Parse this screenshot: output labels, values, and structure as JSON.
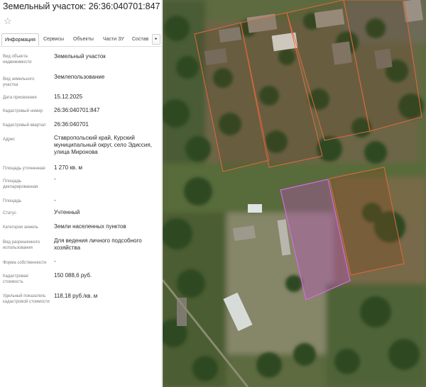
{
  "header": {
    "title": "Земельный участок: 26:36:040701:847",
    "favorite_icon": "star-outline-icon"
  },
  "tabs": [
    {
      "label": "Информация",
      "active": true
    },
    {
      "label": "Сервисы",
      "active": false
    },
    {
      "label": "Объекты",
      "active": false
    },
    {
      "label": "Части ЗУ",
      "active": false
    },
    {
      "label": "Состав",
      "active": false
    }
  ],
  "tabs_more_icon": "chevron-right-icon",
  "tabs_more_glyph": "▸",
  "fields": {
    "object_type": {
      "label": "Вид объекта недвижимости",
      "value": "Земельный участок"
    },
    "land_type": {
      "label": "Вид земельного участка",
      "value": "Землепользование"
    },
    "assigned_date": {
      "label": "Дата присвоения",
      "value": "15.12.2025"
    },
    "cadastral_number": {
      "label": "Кадастровый номер",
      "value": "26:36:040701:847"
    },
    "cadastral_quarter": {
      "label": "Кадастровый квартал",
      "value": "26:36:040701"
    },
    "address": {
      "label": "Адрес",
      "value": "Ставропольский край, Курский муниципальный округ, село Эдиссия, улица Миронова"
    },
    "area_specified": {
      "label": "Площадь уточненная",
      "value": "1 270 кв. м"
    },
    "area_declared": {
      "label": "Площадь декларированная",
      "value": "-"
    },
    "area": {
      "label": "Площадь",
      "value": "-"
    },
    "status": {
      "label": "Статус",
      "value": "Учтенный"
    },
    "land_category": {
      "label": "Категория земель",
      "value": "Земли населенных пунктов"
    },
    "permitted_use": {
      "label": "Вид разрешенного использования",
      "value": "Для ведения личного подсобного хозяйства"
    },
    "ownership_form": {
      "label": "Форма собственности",
      "value": "-"
    },
    "cadastral_value": {
      "label": "Кадастровая стоимость",
      "value": "150 088,6 руб."
    },
    "specific_value": {
      "label": "Удельный показатель кадастровой стоимости",
      "value": "118,18 руб./кв. м"
    }
  },
  "map": {
    "type": "satellite",
    "selected_parcel_color": "#c04fc8",
    "neighbor_parcel_color": "#e0693f"
  }
}
